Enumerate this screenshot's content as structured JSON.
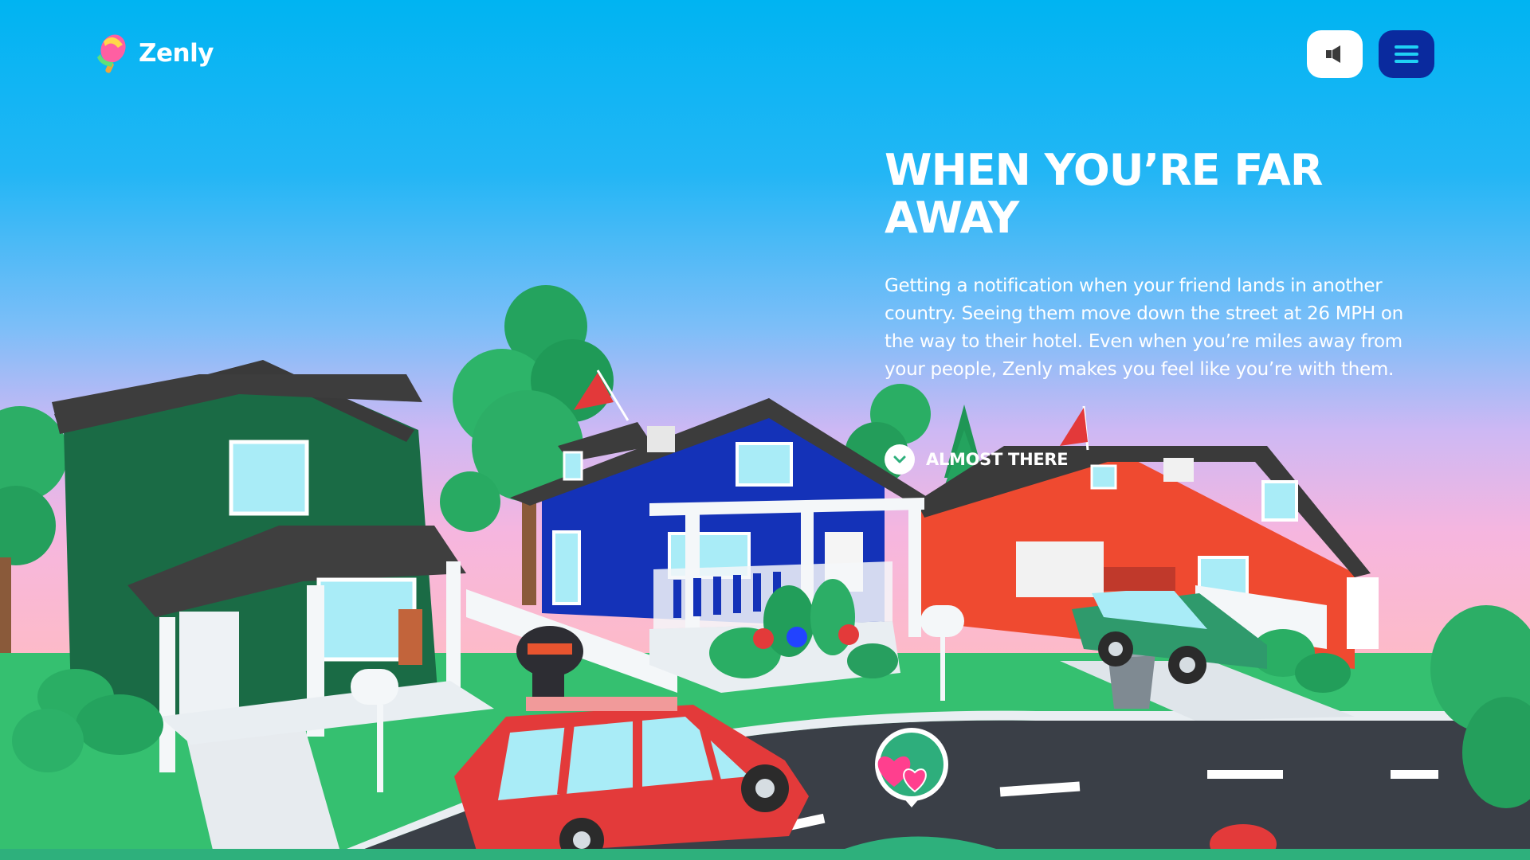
{
  "brand": {
    "name": "Zenly",
    "icon": "popsicle-logo-icon"
  },
  "header": {
    "sound_button": {
      "icon": "speaker-icon",
      "label": "Sound"
    },
    "menu_button": {
      "icon": "hamburger-menu-icon",
      "label": "Menu"
    }
  },
  "hero": {
    "title": "WHEN YOU’RE FAR AWAY",
    "body": "Getting a notification when your friend lands in another country. Seeing them move down the street at 26 MPH on the way to their hotel. Even when you’re miles away from your people, Zenly makes you feel like you’re with them.",
    "cta": {
      "label": "ALMOST THERE",
      "icon": "chevron-down-icon"
    }
  },
  "map_pin": {
    "icon": "hearts-pin-icon"
  },
  "colors": {
    "sky_top": "#00b4f2",
    "sky_bottom": "#ffb9d6",
    "menu_button": "#0a2a9e",
    "grass": "#35c070",
    "footer": "#2eb07c",
    "green_house": "#1a6b45",
    "blue_house": "#1432b8",
    "red_house": "#ef4a30"
  }
}
